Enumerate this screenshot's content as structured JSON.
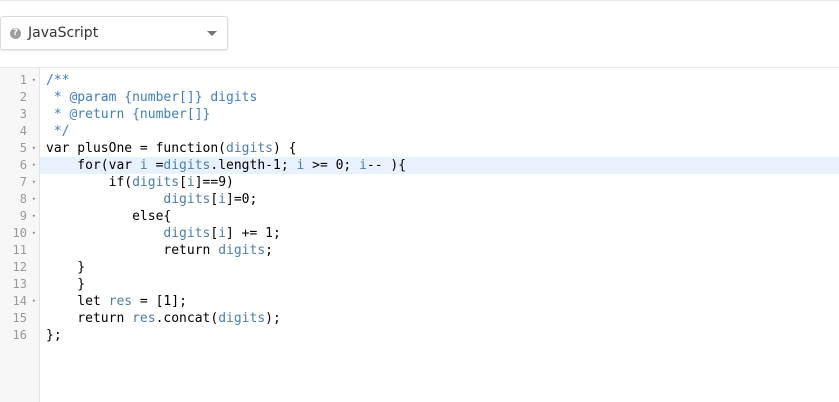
{
  "toolbar": {
    "language_label": "JavaScript",
    "help_glyph": "?"
  },
  "editor": {
    "active_line": 6,
    "lines": [
      {
        "no": "1",
        "fold": true,
        "text": "/**"
      },
      {
        "no": "2",
        "fold": false,
        "text": " * @param {number[]} digits"
      },
      {
        "no": "3",
        "fold": false,
        "text": " * @return {number[]}"
      },
      {
        "no": "4",
        "fold": false,
        "text": " */"
      },
      {
        "no": "5",
        "fold": true,
        "text": "var plusOne = function(digits) {"
      },
      {
        "no": "6",
        "fold": true,
        "text": "    for(var i =digits.length-1; i >= 0; i-- ){"
      },
      {
        "no": "7",
        "fold": true,
        "text": "        if(digits[i]==9)"
      },
      {
        "no": "8",
        "fold": true,
        "text": "               digits[i]=0;"
      },
      {
        "no": "9",
        "fold": true,
        "text": "           else{"
      },
      {
        "no": "10",
        "fold": true,
        "text": "               digits[i] += 1;"
      },
      {
        "no": "11",
        "fold": false,
        "text": "               return digits;"
      },
      {
        "no": "12",
        "fold": false,
        "text": "    }"
      },
      {
        "no": "13",
        "fold": false,
        "text": "    }"
      },
      {
        "no": "14",
        "fold": true,
        "text": "    let res = [1];"
      },
      {
        "no": "15",
        "fold": false,
        "text": "    return res.concat(digits);"
      },
      {
        "no": "16",
        "fold": false,
        "text": "};"
      }
    ]
  },
  "colors": {
    "comment": "#3f7fbf",
    "variable": "#4c7fa6",
    "active_line_bg": "#e8f2ff",
    "gutter_bg": "#f7f7f7"
  },
  "icons": {
    "help": "help-circle-icon",
    "caret": "chevron-down-icon",
    "fold": "fold-arrow-icon"
  }
}
